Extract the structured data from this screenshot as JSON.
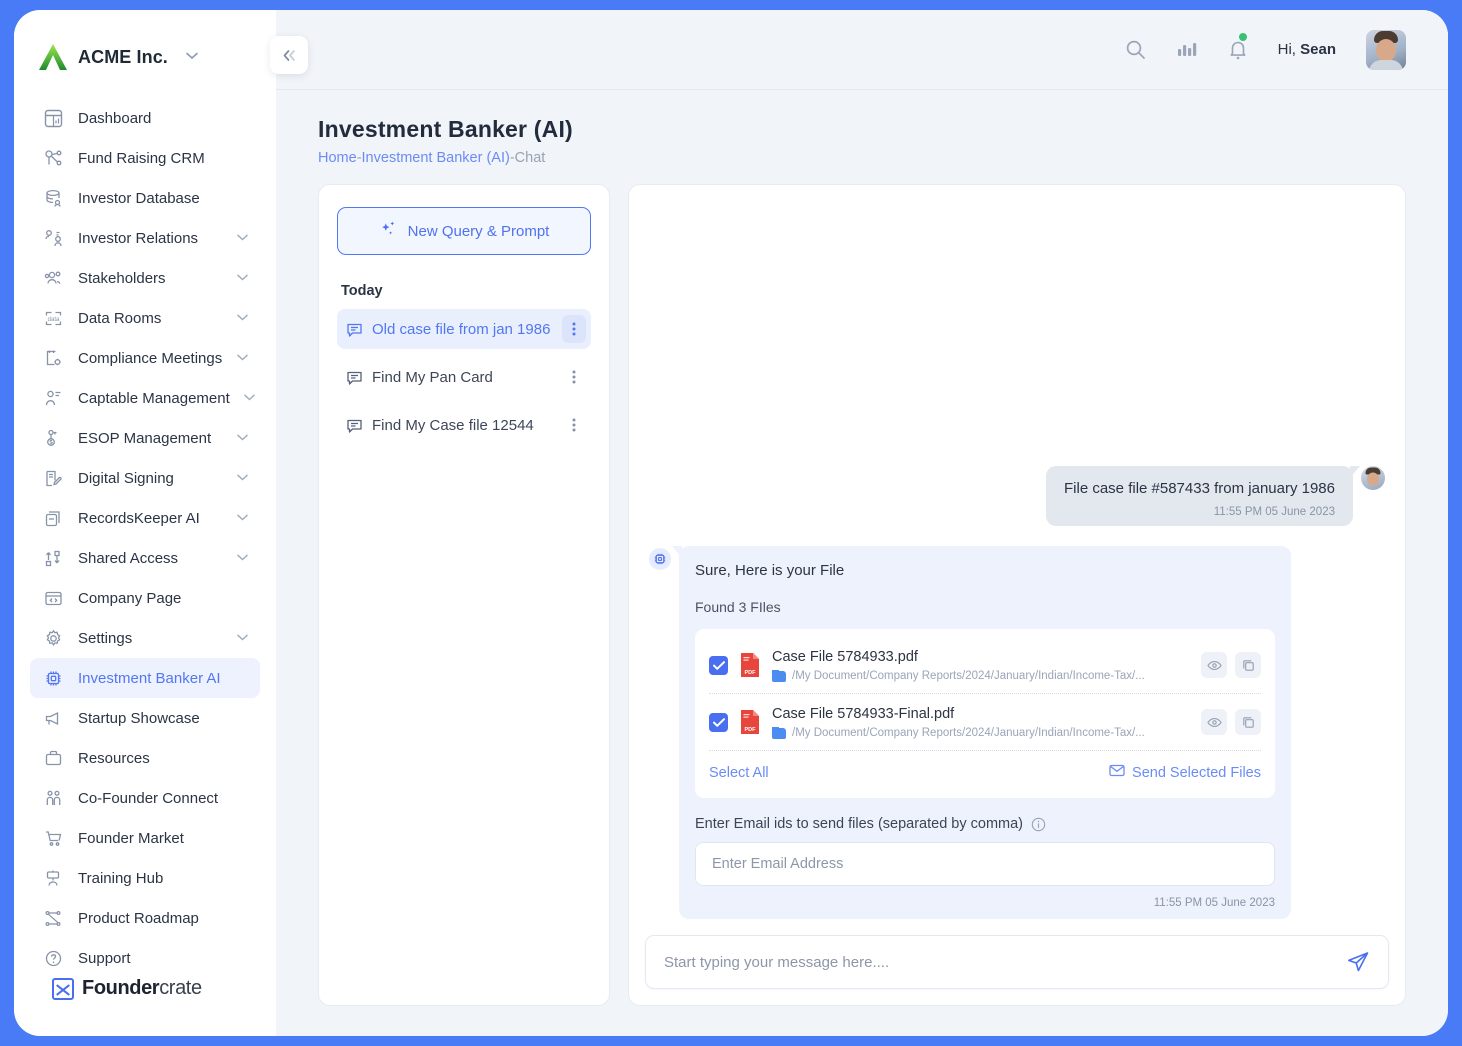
{
  "brand": {
    "name": "ACME Inc.",
    "caret": "chevron-down"
  },
  "sidebar": {
    "items": [
      {
        "label": "Dashboard",
        "icon": "dashboard-icon",
        "expandable": false
      },
      {
        "label": "Fund Raising CRM",
        "icon": "crm-icon",
        "expandable": false
      },
      {
        "label": "Investor Database",
        "icon": "database-icon",
        "expandable": false
      },
      {
        "label": "Investor Relations",
        "icon": "investor-relations-icon",
        "expandable": true
      },
      {
        "label": "Stakeholders",
        "icon": "stakeholders-icon",
        "expandable": true
      },
      {
        "label": "Data Rooms",
        "icon": "data-rooms-icon",
        "expandable": true
      },
      {
        "label": "Compliance Meetings",
        "icon": "compliance-icon",
        "expandable": true
      },
      {
        "label": "Captable Management",
        "icon": "captable-icon",
        "expandable": true
      },
      {
        "label": "ESOP Management",
        "icon": "esop-icon",
        "expandable": true
      },
      {
        "label": "Digital Signing",
        "icon": "signing-icon",
        "expandable": true
      },
      {
        "label": "RecordsKeeper AI",
        "icon": "records-icon",
        "expandable": true
      },
      {
        "label": "Shared Access",
        "icon": "shared-access-icon",
        "expandable": true
      },
      {
        "label": "Company Page",
        "icon": "company-page-icon",
        "expandable": false
      },
      {
        "label": "Settings",
        "icon": "gear-icon",
        "expandable": true
      },
      {
        "label": "Investment Banker AI",
        "icon": "chip-icon",
        "expandable": false,
        "active": true
      },
      {
        "label": "Startup Showcase",
        "icon": "megaphone-icon",
        "expandable": false
      },
      {
        "label": "Resources",
        "icon": "briefcase-icon",
        "expandable": false
      },
      {
        "label": "Co-Founder Connect",
        "icon": "cofounder-icon",
        "expandable": false
      },
      {
        "label": "Founder Market",
        "icon": "cart-icon",
        "expandable": false
      },
      {
        "label": "Training Hub",
        "icon": "training-icon",
        "expandable": false
      },
      {
        "label": "Product Roadmap",
        "icon": "roadmap-icon",
        "expandable": false
      },
      {
        "label": "Support",
        "icon": "question-icon",
        "expandable": false
      }
    ],
    "footer_logo": {
      "bold": "Founder",
      "light": "crate"
    },
    "collapse_icon": "double-chevron-left-icon"
  },
  "topbar": {
    "search_icon": "search-icon",
    "analytics_icon": "bar-chart-icon",
    "notifications_icon": "bell-icon",
    "greeting_prefix": "Hi, ",
    "user_name": "Sean",
    "avatar": "user-avatar"
  },
  "page": {
    "title": "Investment Banker (AI)",
    "breadcrumb": {
      "home": "Home",
      "section": "Investment Banker (AI)",
      "current": "Chat",
      "separator": "-"
    }
  },
  "chatlist": {
    "new_query_label": "New Query & Prompt",
    "new_query_icon": "sparkles-icon",
    "group_label": "Today",
    "items": [
      {
        "label": "Old case file from jan 1986",
        "active": true
      },
      {
        "label": "Find My Pan Card",
        "active": false
      },
      {
        "label": "Find My Case file 12544",
        "active": false
      }
    ]
  },
  "conversation": {
    "user_message": {
      "text": "File case file #587433 from january 1986",
      "time": "11:55 PM 05 June 2023"
    },
    "ai_message": {
      "greeting": "Sure, Here is your File",
      "found_label": "Found 3 FIles",
      "files": [
        {
          "name": "Case File 5784933.pdf",
          "path": "/My Document/Company Reports/2024/January/Indian/Income-Tax/...",
          "checked": true,
          "type": "PDF"
        },
        {
          "name": "Case File 5784933-Final.pdf",
          "path": "/My Document/Company Reports/2024/January/Indian/Income-Tax/...",
          "checked": true,
          "type": "PDF"
        }
      ],
      "select_all_label": "Select All",
      "send_selected_label": "Send Selected Files",
      "send_selected_icon": "envelope-icon",
      "email_label": "Enter Email ids to send files (separated by comma)",
      "email_info_icon": "info-icon",
      "email_placeholder": "Enter Email Address",
      "email_value": "",
      "time": "11:55 PM 05 June 2023"
    }
  },
  "composer": {
    "placeholder": "Start typing your message here....",
    "value": "",
    "send_icon": "send-icon"
  },
  "colors": {
    "accent": "#4a6ef0",
    "accent_light": "#eef2fe",
    "page_bg": "#f1f4f8",
    "frame_border": "#4a7bf7",
    "pdf_red": "#e8453c",
    "status_green": "#38c172"
  }
}
